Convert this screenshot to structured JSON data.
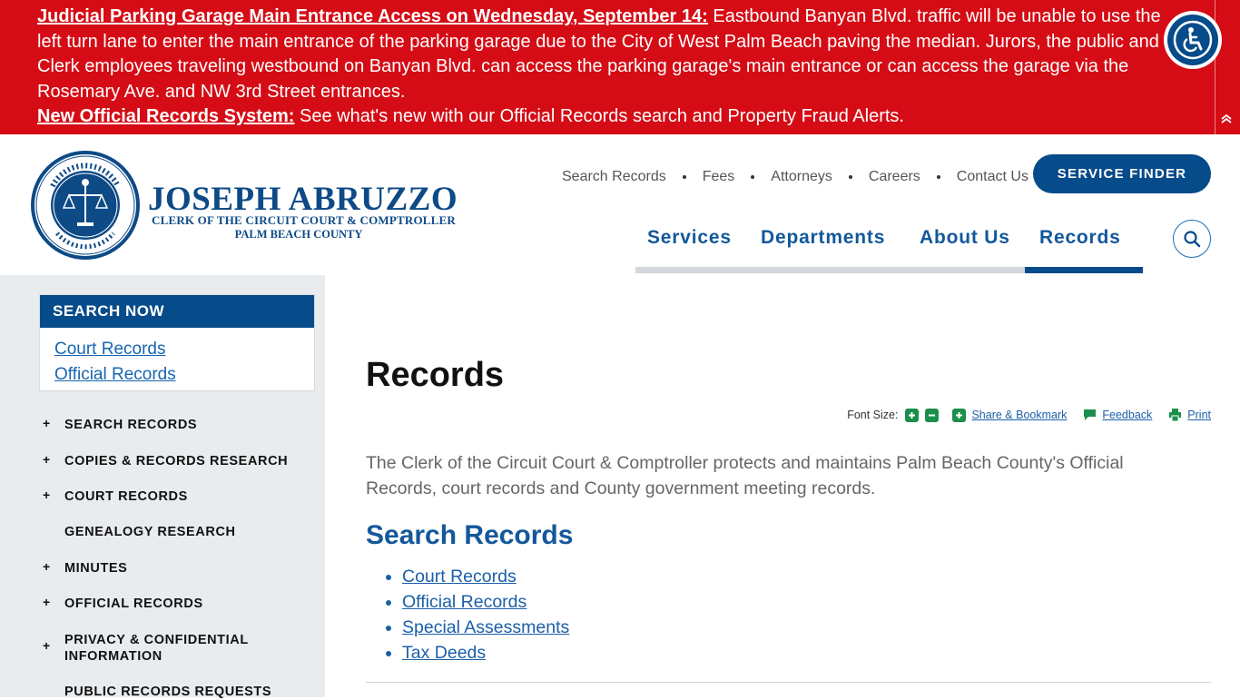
{
  "alert": {
    "item1_link": "Judicial Parking Garage Main Entrance Access on Wednesday, September 14:",
    "item1_text": " Eastbound Banyan Blvd. traffic will be unable to use the left turn lane to enter the main entrance of the parking garage due to the City of West Palm Beach paving the median. Jurors, the public and Clerk employees traveling westbound on Banyan Blvd. can access the parking garage's main entrance or can access the garage via the Rosemary Ave. and NW 3rd Street entrances.",
    "item2_link": "New Official Records System:",
    "item2_text": " See what's new with our Official Records search and Property Fraud Alerts.",
    "collapse_glyph": "⌃",
    "bg_color": "#d50c15"
  },
  "brand": {
    "name": "JOSEPH ABRUZZO",
    "subtitle1": "CLERK OF THE CIRCUIT COURT & COMPTROLLER",
    "subtitle2": "PALM BEACH COUNTY",
    "seal_outer_text": "CLERK OF THE CIRCUIT COURT & COMPTROLLER",
    "seal_bottom_text": "PALM BEACH COUNTY",
    "color": "#0d4a86"
  },
  "utility_nav": [
    "Search Records",
    "Fees",
    "Attorneys",
    "Careers",
    "Contact Us"
  ],
  "service_finder": "SERVICE FINDER",
  "main_nav": {
    "services": "Services",
    "departments": "Departments",
    "about": "About Us",
    "records": "Records",
    "active": "Records"
  },
  "sidebar": {
    "search_now_title": "SEARCH NOW",
    "search_now_links": [
      "Court Records",
      "Official Records"
    ],
    "items": [
      {
        "label": "SEARCH RECORDS",
        "expandable": true
      },
      {
        "label": "COPIES & RECORDS RESEARCH",
        "expandable": true
      },
      {
        "label": "COURT RECORDS",
        "expandable": true
      },
      {
        "label": "GENEALOGY RESEARCH",
        "expandable": false
      },
      {
        "label": "MINUTES",
        "expandable": true
      },
      {
        "label": "OFFICIAL RECORDS",
        "expandable": true
      },
      {
        "label": "PRIVACY & CONFIDENTIAL INFORMATION",
        "expandable": true
      },
      {
        "label": "PUBLIC RECORDS REQUESTS",
        "expandable": false
      }
    ],
    "plus_glyph": "+"
  },
  "main": {
    "title": "Records",
    "font_size_label": "Font Size:",
    "share_label": "Share & Bookmark",
    "feedback_label": "Feedback",
    "print_label": "Print",
    "intro": "The Clerk of the Circuit Court & Comptroller protects and maintains Palm Beach County's Official Records, court records and County government meeting records.",
    "section_title": "Search Records",
    "links": [
      "Court Records",
      "Official Records",
      "Special Assessments",
      "Tax Deeds"
    ]
  },
  "colors": {
    "primary_blue": "#064b8a",
    "link_blue": "#1b5fa8",
    "tool_green": "#1b8e4b",
    "sidebar_bg": "#e9ecef"
  },
  "icons": [
    "accessibility-icon",
    "chevron-up-icon",
    "county-seal-icon",
    "search-icon",
    "plus-icon",
    "minus-icon",
    "share-icon",
    "feedback-icon",
    "print-icon"
  ]
}
